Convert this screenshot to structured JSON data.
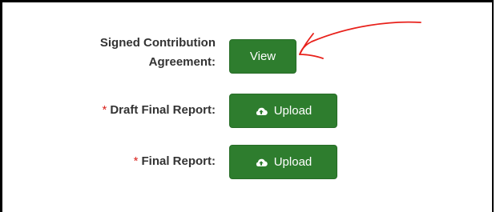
{
  "form": {
    "signed_contribution": {
      "label_line1": "Signed Contribution",
      "label_line2": "Agreement:",
      "button_label": "View"
    },
    "draft_final_report": {
      "required_marker": "*",
      "label": "Draft Final Report:",
      "button_label": "Upload",
      "button_icon": "cloud-upload-icon"
    },
    "final_report": {
      "required_marker": "*",
      "label": "Final Report:",
      "button_label": "Upload",
      "button_icon": "cloud-upload-icon"
    }
  },
  "annotation": {
    "arrow_color": "#e8211b"
  },
  "colors": {
    "button_bg": "#2e7d2e",
    "label_text": "#333333",
    "required_asterisk": "#d9231d"
  }
}
